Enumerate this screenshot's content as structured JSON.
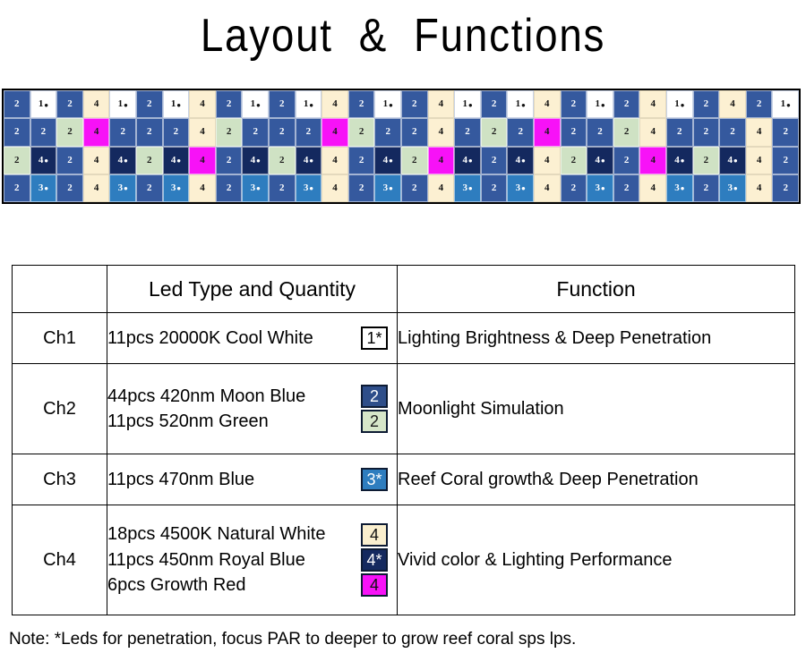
{
  "page": {
    "title": "Layout  &  Functions",
    "note": "Note: *Leds for penetration, focus PAR to deeper to grow reef coral sps lps."
  },
  "legend_colors": {
    "blue_2": "#35599E",
    "green_2": "#CFE2C4",
    "white_1": "#FFFFFF",
    "cream_4": "#FCF0D2",
    "magenta_4": "#F712F7",
    "navy_4": "#14295F",
    "cyan_3": "#2E7DBF"
  },
  "led_grid": {
    "columns": 30,
    "rows": 4,
    "cell_types": {
      "b2": {
        "label": "2",
        "star": false,
        "class": "t-blue2"
      },
      "g2": {
        "label": "2",
        "star": false,
        "class": "t-green2"
      },
      "w1": {
        "label": "1",
        "star": true,
        "class": "t-white1"
      },
      "c4": {
        "label": "4",
        "star": false,
        "class": "t-cream4"
      },
      "m4": {
        "label": "4",
        "star": false,
        "class": "t-magenta4"
      },
      "n4": {
        "label": "4",
        "star": true,
        "class": "t-navy4"
      },
      "y3": {
        "label": "3",
        "star": true,
        "class": "t-cyan3"
      }
    },
    "cells": [
      [
        "b2",
        "w1",
        "b2",
        "c4",
        "w1",
        "b2",
        "w1",
        "c4",
        "b2",
        "w1",
        "b2",
        "w1",
        "c4",
        "b2",
        "w1",
        "b2",
        "c4",
        "w1",
        "b2",
        "w1",
        "c4",
        "b2",
        "w1",
        "b2",
        "c4",
        "w1",
        "b2",
        "c4",
        "b2",
        "w1"
      ],
      [
        "b2",
        "b2",
        "g2",
        "m4",
        "b2",
        "b2",
        "b2",
        "c4",
        "g2",
        "b2",
        "b2",
        "b2",
        "m4",
        "g2",
        "b2",
        "b2",
        "c4",
        "b2",
        "g2",
        "b2",
        "m4",
        "b2",
        "b2",
        "g2",
        "c4",
        "b2",
        "b2",
        "b2",
        "c4",
        "b2"
      ],
      [
        "g2",
        "n4",
        "b2",
        "c4",
        "n4",
        "g2",
        "n4",
        "m4",
        "b2",
        "n4",
        "g2",
        "n4",
        "c4",
        "b2",
        "n4",
        "g2",
        "m4",
        "n4",
        "b2",
        "n4",
        "c4",
        "g2",
        "n4",
        "b2",
        "m4",
        "n4",
        "g2",
        "n4",
        "c4",
        "b2"
      ],
      [
        "b2",
        "y3",
        "b2",
        "c4",
        "y3",
        "b2",
        "y3",
        "c4",
        "b2",
        "y3",
        "b2",
        "y3",
        "c4",
        "b2",
        "y3",
        "b2",
        "c4",
        "y3",
        "b2",
        "y3",
        "c4",
        "b2",
        "y3",
        "b2",
        "c4",
        "y3",
        "b2",
        "y3",
        "c4",
        "b2"
      ]
    ]
  },
  "table": {
    "headers": {
      "channel": "",
      "led_type": "Led Type and Quantity",
      "function": "Function"
    },
    "rows": [
      {
        "channel": "Ch1",
        "lines": [
          {
            "text": "11pcs 20000K Cool White",
            "badge": "1*",
            "badge_class": "badge-1"
          }
        ],
        "function": "Lighting Brightness & Deep Penetration"
      },
      {
        "channel": "Ch2",
        "lines": [
          {
            "text": "44pcs 420nm Moon Blue",
            "badge": "2",
            "badge_class": "badge-2blue"
          },
          {
            "text": "11pcs 520nm Green",
            "badge": "2",
            "badge_class": "badge-2green"
          }
        ],
        "function": "Moonlight Simulation"
      },
      {
        "channel": "Ch3",
        "lines": [
          {
            "text": "11pcs 470nm Blue",
            "badge": "3*",
            "badge_class": "badge-3"
          }
        ],
        "function": "Reef Coral growth& Deep Penetration"
      },
      {
        "channel": "Ch4",
        "lines": [
          {
            "text": "18pcs 4500K Natural White",
            "badge": "4",
            "badge_class": "badge-4cream"
          },
          {
            "text": "11pcs 450nm Royal Blue",
            "badge": "4*",
            "badge_class": "badge-4navy"
          },
          {
            "text": "6pcs Growth Red",
            "badge": "4",
            "badge_class": "badge-4magenta"
          }
        ],
        "function": "Vivid color & Lighting Performance"
      }
    ]
  }
}
